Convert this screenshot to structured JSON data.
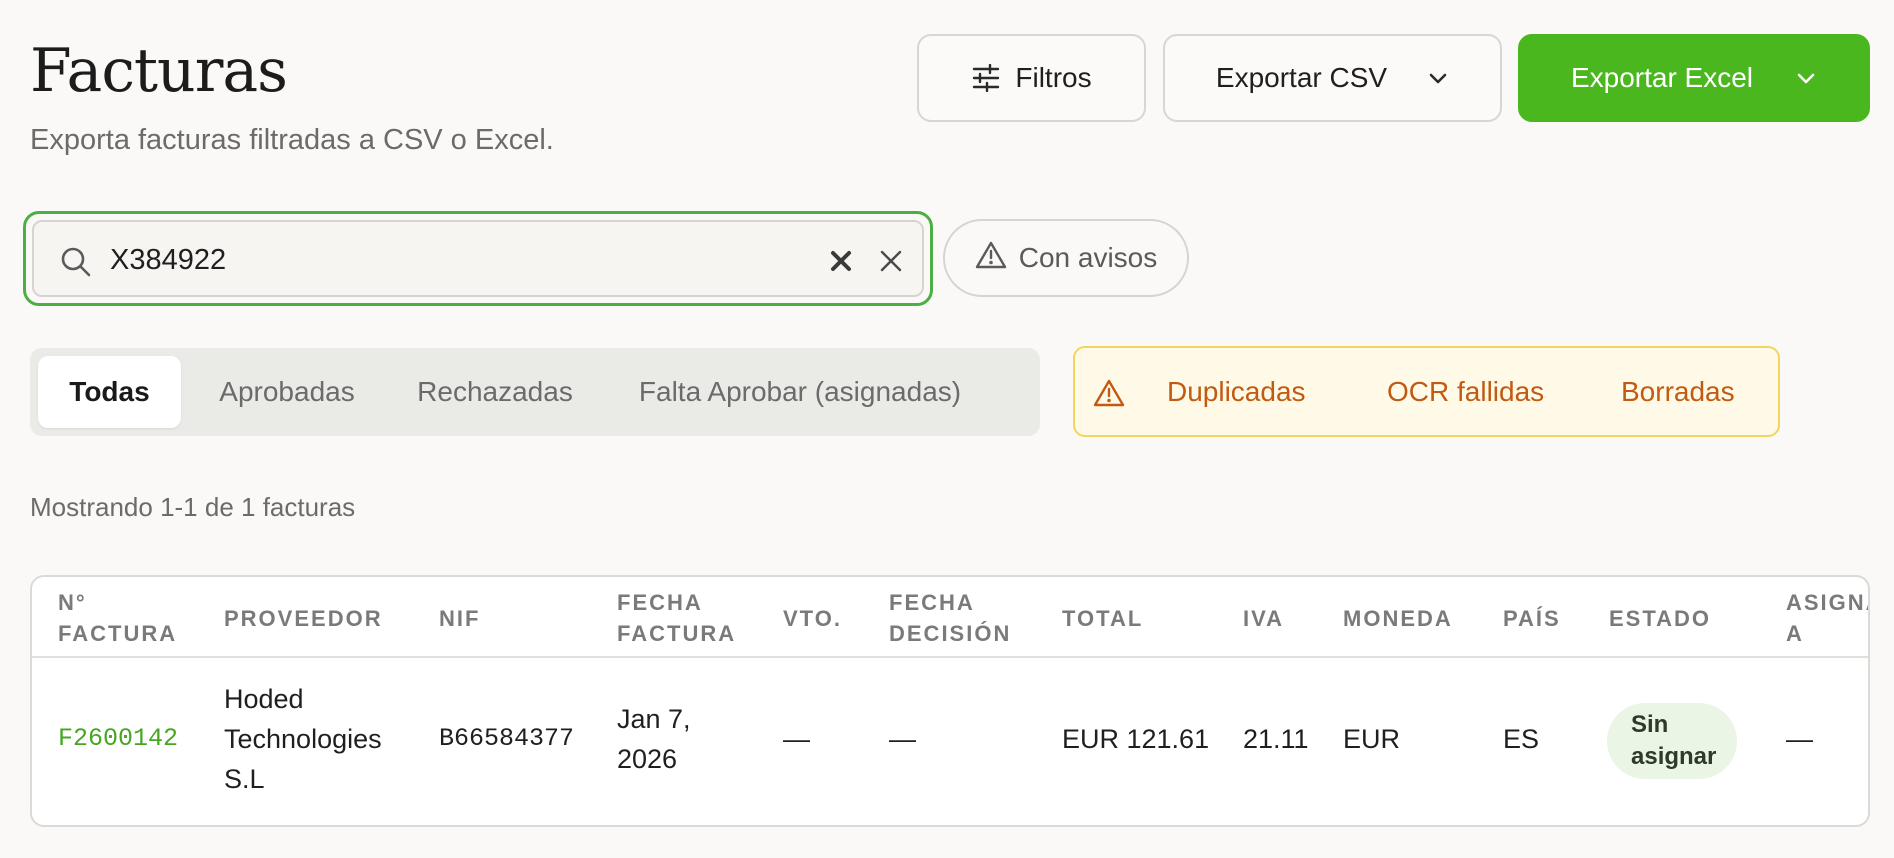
{
  "header": {
    "title": "Facturas",
    "subtitle": "Exporta facturas filtradas a CSV o Excel."
  },
  "toolbar": {
    "filters_label": "Filtros",
    "export_csv_label": "Exportar CSV",
    "export_excel_label": "Exportar Excel"
  },
  "search": {
    "value": "X384922",
    "placeholder": ""
  },
  "warnings_pill": {
    "label": "Con avisos"
  },
  "tabs": [
    {
      "label": "Todas",
      "active": true
    },
    {
      "label": "Aprobadas",
      "active": false
    },
    {
      "label": "Rechazadas",
      "active": false
    },
    {
      "label": "Falta Aprobar (asignadas)",
      "active": false
    }
  ],
  "warning_filters": [
    {
      "label": "Duplicadas"
    },
    {
      "label": "OCR fallidas"
    },
    {
      "label": "Borradas"
    }
  ],
  "results_count": "Mostrando 1-1 de 1 facturas",
  "table": {
    "columns": [
      {
        "line1": "N°",
        "line2": "FACTURA"
      },
      {
        "line1": "PROVEEDOR",
        "line2": ""
      },
      {
        "line1": "NIF",
        "line2": ""
      },
      {
        "line1": "FECHA",
        "line2": "FACTURA"
      },
      {
        "line1": "VTO.",
        "line2": ""
      },
      {
        "line1": "FECHA",
        "line2": "DECISIÓN"
      },
      {
        "line1": "TOTAL",
        "line2": ""
      },
      {
        "line1": "IVA",
        "line2": ""
      },
      {
        "line1": "MONEDA",
        "line2": ""
      },
      {
        "line1": "PAÍS",
        "line2": ""
      },
      {
        "line1": "ESTADO",
        "line2": ""
      },
      {
        "line1": "ASIGNA",
        "line2": "A"
      }
    ],
    "rows": [
      {
        "invoice_number": "F2600142",
        "supplier": [
          "Hoded",
          "Technologies",
          "S.L"
        ],
        "nif": "B66584377",
        "invoice_date": [
          "Jan 7,",
          "2026"
        ],
        "due": "—",
        "decision_date": "—",
        "total": "EUR 121.61",
        "iva": "21.11",
        "currency": "EUR",
        "country": "ES",
        "status": [
          "Sin",
          "asignar"
        ],
        "assigned_to": "—"
      }
    ]
  },
  "colors": {
    "accent_green": "#4bb71f",
    "warning_text": "#c25a12",
    "warning_bg": "#fefae7"
  }
}
